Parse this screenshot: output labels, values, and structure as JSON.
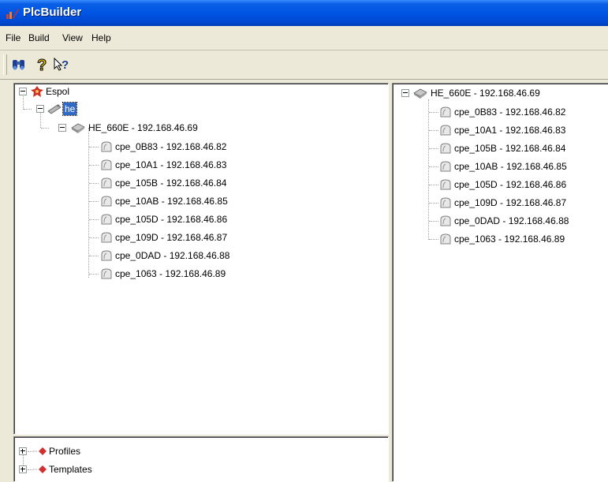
{
  "window": {
    "title": "PlcBuilder"
  },
  "menu": {
    "items": [
      "File",
      "Build",
      "View",
      "Help"
    ]
  },
  "toolbar": {
    "buttons": [
      "binoculars-icon",
      "help-icon",
      "context-help-icon"
    ]
  },
  "left_tree": {
    "root": "Espol",
    "he": "he",
    "device": "HE_660E - 192.168.46.69",
    "children": [
      "cpe_0B83 - 192.168.46.82",
      "cpe_10A1 - 192.168.46.83",
      "cpe_105B - 192.168.46.84",
      "cpe_10AB - 192.168.46.85",
      "cpe_105D - 192.168.46.86",
      "cpe_109D - 192.168.46.87",
      "cpe_0DAD - 192.168.46.88",
      "cpe_1063 - 192.168.46.89"
    ]
  },
  "bottom_tree": {
    "items": [
      "Profiles",
      "Templates"
    ]
  },
  "right_tree": {
    "device": "HE_660E - 192.168.46.69",
    "children": [
      "cpe_0B83 - 192.168.46.82",
      "cpe_10A1 - 192.168.46.83",
      "cpe_105B - 192.168.46.84",
      "cpe_10AB - 192.168.46.85",
      "cpe_105D - 192.168.46.86",
      "cpe_109D - 192.168.46.87",
      "cpe_0DAD - 192.168.46.88",
      "cpe_1063 - 192.168.46.89"
    ]
  }
}
